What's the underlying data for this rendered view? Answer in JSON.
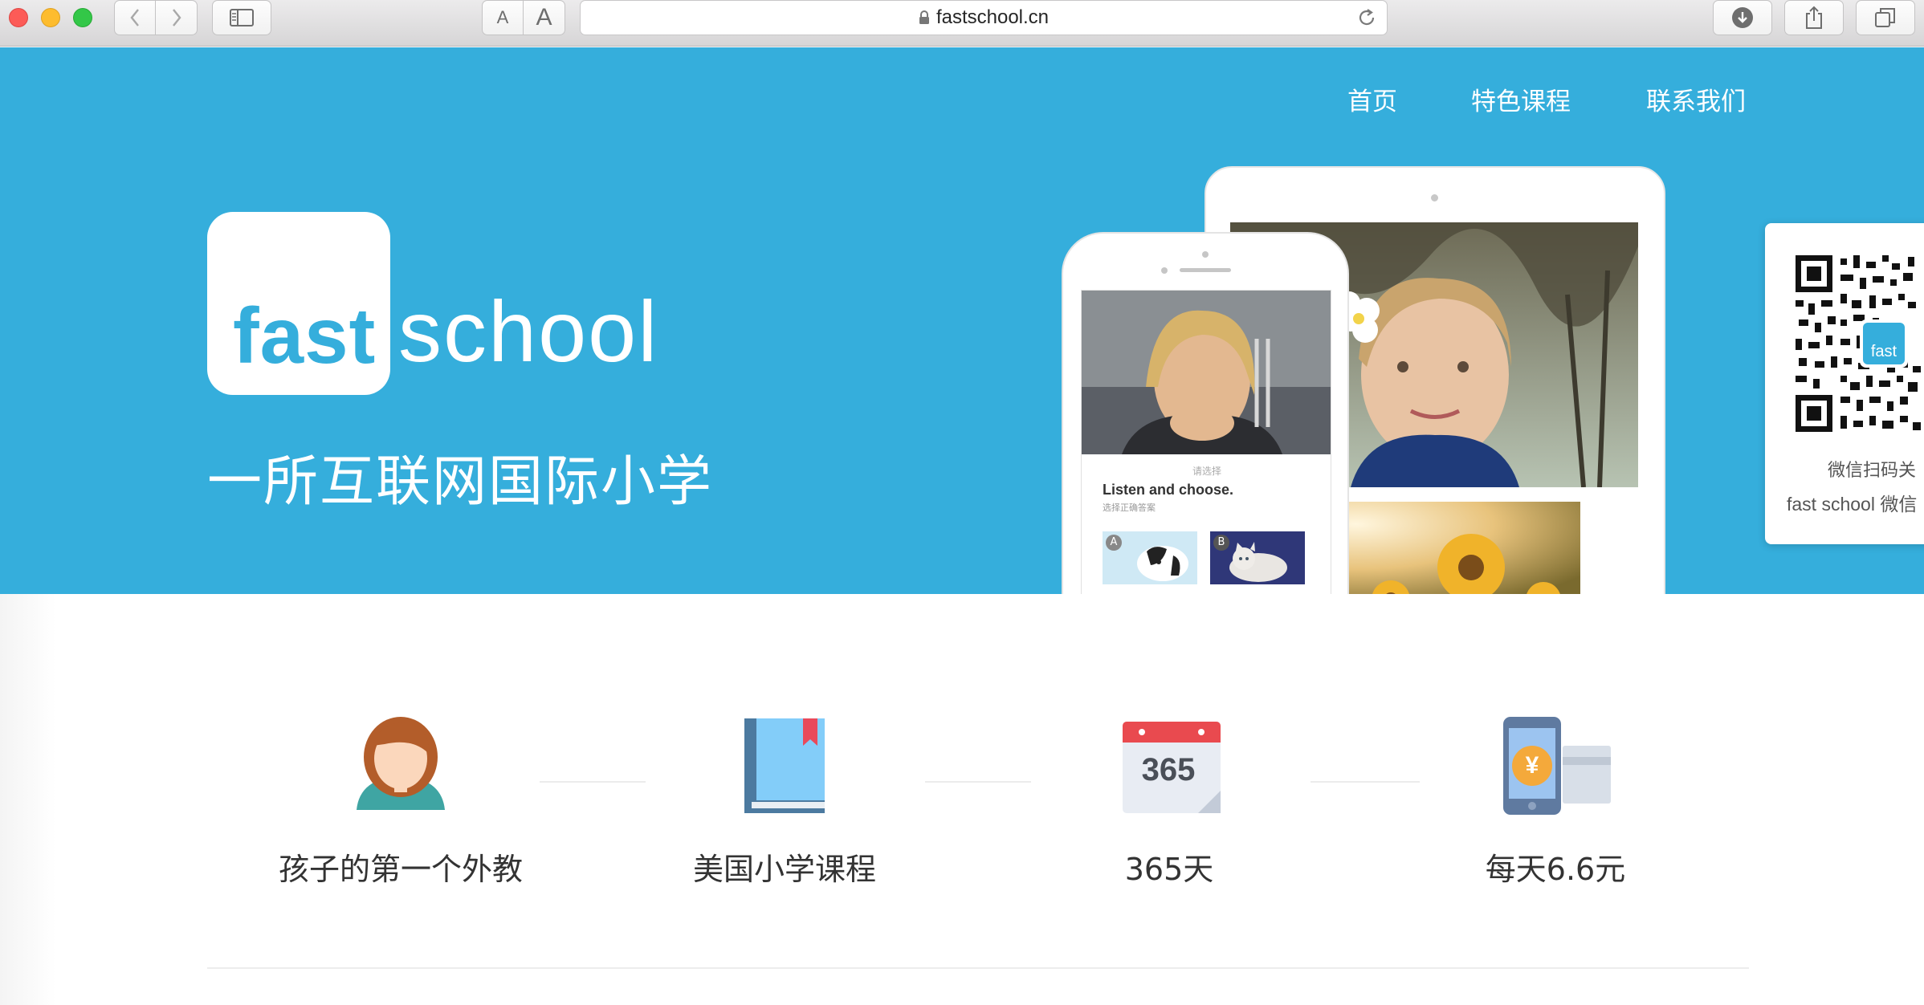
{
  "browser": {
    "url": "fastschool.cn",
    "text_small_label": "A",
    "text_large_label": "A"
  },
  "nav": {
    "home": "首页",
    "courses": "特色课程",
    "contact": "联系我们"
  },
  "hero": {
    "logo_fast": "fast",
    "logo_school": "school",
    "tagline": "一所互联网国际小学",
    "phone_app": {
      "small_header": "请选择",
      "instruction": "Listen and choose.",
      "instruction_sub": "选择正确答案",
      "option_a": "A",
      "option_b": "B"
    }
  },
  "qr": {
    "badge": "fast",
    "line1": "微信扫码关",
    "line2": "fast school 微信"
  },
  "features": [
    {
      "icon": "teacher-icon",
      "label": "孩子的第一个外教"
    },
    {
      "icon": "book-icon",
      "label": "美国小学课程"
    },
    {
      "icon": "calendar-icon",
      "label": "365天",
      "calendar_number": "365"
    },
    {
      "icon": "payment-icon",
      "label": "每天6.6元",
      "currency_symbol": "¥"
    }
  ],
  "colors": {
    "brand": "#35aedc",
    "text": "#333333"
  }
}
